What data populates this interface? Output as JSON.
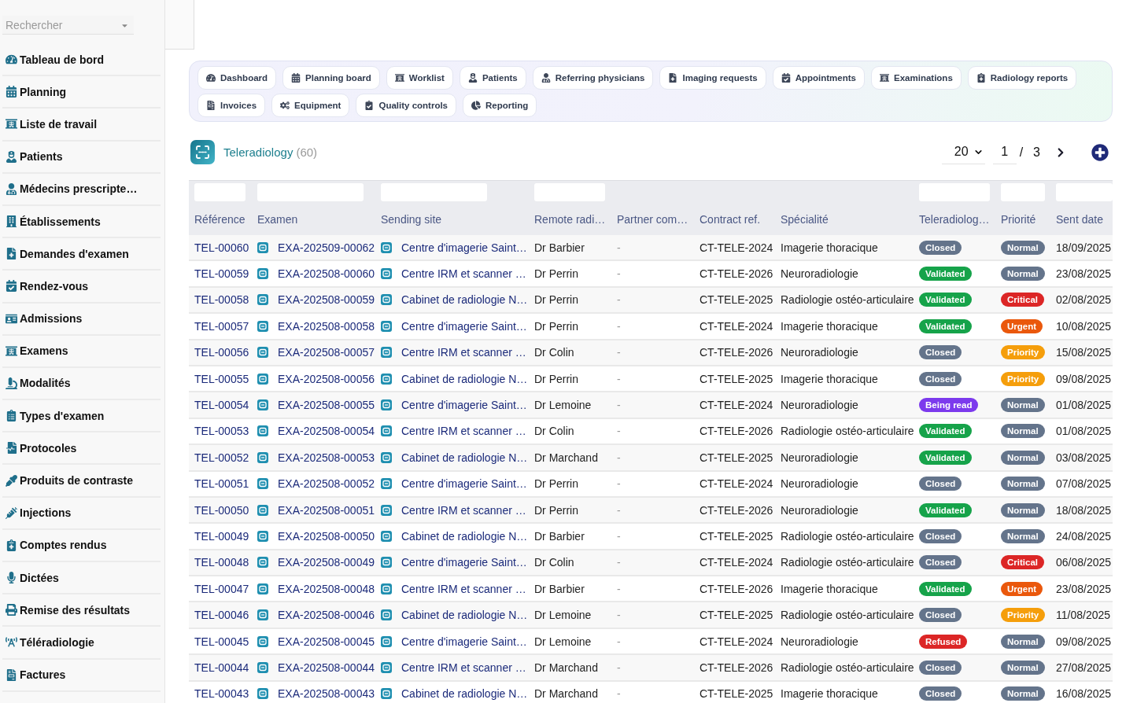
{
  "sidebar": {
    "search": {
      "placeholder": "Rechercher"
    },
    "items": [
      {
        "label": "Tableau de bord"
      },
      {
        "label": "Planning"
      },
      {
        "label": "Liste de travail"
      },
      {
        "label": "Patients"
      },
      {
        "label": "Médecins prescripte…"
      },
      {
        "label": "Établissements"
      },
      {
        "label": "Demandes d'examen"
      },
      {
        "label": "Rendez-vous"
      },
      {
        "label": "Admissions"
      },
      {
        "label": "Examens"
      },
      {
        "label": "Modalités"
      },
      {
        "label": "Types d'examen"
      },
      {
        "label": "Protocoles"
      },
      {
        "label": "Produits de contraste"
      },
      {
        "label": "Injections"
      },
      {
        "label": "Comptes rendus"
      },
      {
        "label": "Dictées"
      },
      {
        "label": "Remise des résultats"
      },
      {
        "label": "Téléradiologie"
      },
      {
        "label": "Factures"
      }
    ]
  },
  "nav_tabs": [
    {
      "label": "Dashboard"
    },
    {
      "label": "Planning board"
    },
    {
      "label": "Worklist"
    },
    {
      "label": "Patients"
    },
    {
      "label": "Referring physicians"
    },
    {
      "label": "Imaging requests"
    },
    {
      "label": "Appointments"
    },
    {
      "label": "Examinations"
    },
    {
      "label": "Radiology reports"
    },
    {
      "label": "Invoices"
    },
    {
      "label": "Equipment"
    },
    {
      "label": "Quality controls"
    },
    {
      "label": "Reporting"
    }
  ],
  "list_header": {
    "title": "Teleradiology",
    "count": "(60)",
    "page_size": "20",
    "page": "1",
    "page_separator": "/",
    "page_count": "3"
  },
  "table": {
    "columns": [
      {
        "label": "Référence",
        "filter": true
      },
      {
        "label": "Examen",
        "filter": true
      },
      {
        "label": "Sending site",
        "filter": true
      },
      {
        "label": "Remote radi…",
        "filter": true
      },
      {
        "label": "Partner com…",
        "filter": false
      },
      {
        "label": "Contract ref.",
        "filter": false
      },
      {
        "label": "Spécialité",
        "filter": false
      },
      {
        "label": "Teleradiolog…",
        "filter": true
      },
      {
        "label": "Priorité",
        "filter": true
      },
      {
        "label": "Sent date",
        "filter": true
      }
    ],
    "rows": [
      {
        "reference": "TEL-00060",
        "exam": "EXA-202509-00062",
        "sending_site": "Centre d'imagerie Saint…",
        "remote_radiologist": "Dr Barbier",
        "partner": "-",
        "contract_ref": "CT-TELE-2024",
        "specialty": "Imagerie thoracique",
        "status": {
          "label": "Closed",
          "color": "#64748b"
        },
        "priority": {
          "label": "Normal",
          "color": "#64748b"
        },
        "sent_date": "18/09/2025"
      },
      {
        "reference": "TEL-00059",
        "exam": "EXA-202508-00060",
        "sending_site": "Centre IRM et scanner …",
        "remote_radiologist": "Dr Perrin",
        "partner": "-",
        "contract_ref": "CT-TELE-2026",
        "specialty": "Neuroradiologie",
        "status": {
          "label": "Validated",
          "color": "#16a34a"
        },
        "priority": {
          "label": "Normal",
          "color": "#64748b"
        },
        "sent_date": "23/08/2025"
      },
      {
        "reference": "TEL-00058",
        "exam": "EXA-202508-00059",
        "sending_site": "Cabinet de radiologie N…",
        "remote_radiologist": "Dr Perrin",
        "partner": "-",
        "contract_ref": "CT-TELE-2025",
        "specialty": "Radiologie ostéo-articulaire",
        "status": {
          "label": "Validated",
          "color": "#16a34a"
        },
        "priority": {
          "label": "Critical",
          "color": "#dc2626"
        },
        "sent_date": "02/08/2025"
      },
      {
        "reference": "TEL-00057",
        "exam": "EXA-202508-00058",
        "sending_site": "Centre d'imagerie Saint…",
        "remote_radiologist": "Dr Perrin",
        "partner": "-",
        "contract_ref": "CT-TELE-2024",
        "specialty": "Imagerie thoracique",
        "status": {
          "label": "Validated",
          "color": "#16a34a"
        },
        "priority": {
          "label": "Urgent",
          "color": "#ea580c"
        },
        "sent_date": "10/08/2025"
      },
      {
        "reference": "TEL-00056",
        "exam": "EXA-202508-00057",
        "sending_site": "Centre IRM et scanner …",
        "remote_radiologist": "Dr Colin",
        "partner": "-",
        "contract_ref": "CT-TELE-2026",
        "specialty": "Neuroradiologie",
        "status": {
          "label": "Closed",
          "color": "#64748b"
        },
        "priority": {
          "label": "Priority",
          "color": "#f59e0b"
        },
        "sent_date": "15/08/2025"
      },
      {
        "reference": "TEL-00055",
        "exam": "EXA-202508-00056",
        "sending_site": "Cabinet de radiologie N…",
        "remote_radiologist": "Dr Perrin",
        "partner": "-",
        "contract_ref": "CT-TELE-2025",
        "specialty": "Imagerie thoracique",
        "status": {
          "label": "Closed",
          "color": "#64748b"
        },
        "priority": {
          "label": "Priority",
          "color": "#f59e0b"
        },
        "sent_date": "09/08/2025"
      },
      {
        "reference": "TEL-00054",
        "exam": "EXA-202508-00055",
        "sending_site": "Centre d'imagerie Saint…",
        "remote_radiologist": "Dr Lemoine",
        "partner": "-",
        "contract_ref": "CT-TELE-2024",
        "specialty": "Neuroradiologie",
        "status": {
          "label": "Being read",
          "color": "#7c3aed"
        },
        "priority": {
          "label": "Normal",
          "color": "#64748b"
        },
        "sent_date": "01/08/2025"
      },
      {
        "reference": "TEL-00053",
        "exam": "EXA-202508-00054",
        "sending_site": "Centre IRM et scanner …",
        "remote_radiologist": "Dr Colin",
        "partner": "-",
        "contract_ref": "CT-TELE-2026",
        "specialty": "Radiologie ostéo-articulaire",
        "status": {
          "label": "Validated",
          "color": "#16a34a"
        },
        "priority": {
          "label": "Normal",
          "color": "#64748b"
        },
        "sent_date": "01/08/2025"
      },
      {
        "reference": "TEL-00052",
        "exam": "EXA-202508-00053",
        "sending_site": "Cabinet de radiologie N…",
        "remote_radiologist": "Dr Marchand",
        "partner": "-",
        "contract_ref": "CT-TELE-2025",
        "specialty": "Neuroradiologie",
        "status": {
          "label": "Validated",
          "color": "#16a34a"
        },
        "priority": {
          "label": "Normal",
          "color": "#64748b"
        },
        "sent_date": "03/08/2025"
      },
      {
        "reference": "TEL-00051",
        "exam": "EXA-202508-00052",
        "sending_site": "Centre d'imagerie Saint…",
        "remote_radiologist": "Dr Perrin",
        "partner": "-",
        "contract_ref": "CT-TELE-2024",
        "specialty": "Neuroradiologie",
        "status": {
          "label": "Closed",
          "color": "#64748b"
        },
        "priority": {
          "label": "Normal",
          "color": "#64748b"
        },
        "sent_date": "07/08/2025"
      },
      {
        "reference": "TEL-00050",
        "exam": "EXA-202508-00051",
        "sending_site": "Centre IRM et scanner …",
        "remote_radiologist": "Dr Perrin",
        "partner": "-",
        "contract_ref": "CT-TELE-2026",
        "specialty": "Neuroradiologie",
        "status": {
          "label": "Validated",
          "color": "#16a34a"
        },
        "priority": {
          "label": "Normal",
          "color": "#64748b"
        },
        "sent_date": "18/08/2025"
      },
      {
        "reference": "TEL-00049",
        "exam": "EXA-202508-00050",
        "sending_site": "Cabinet de radiologie N…",
        "remote_radiologist": "Dr Barbier",
        "partner": "-",
        "contract_ref": "CT-TELE-2025",
        "specialty": "Radiologie ostéo-articulaire",
        "status": {
          "label": "Closed",
          "color": "#64748b"
        },
        "priority": {
          "label": "Normal",
          "color": "#64748b"
        },
        "sent_date": "24/08/2025"
      },
      {
        "reference": "TEL-00048",
        "exam": "EXA-202508-00049",
        "sending_site": "Centre d'imagerie Saint…",
        "remote_radiologist": "Dr Colin",
        "partner": "-",
        "contract_ref": "CT-TELE-2024",
        "specialty": "Radiologie ostéo-articulaire",
        "status": {
          "label": "Closed",
          "color": "#64748b"
        },
        "priority": {
          "label": "Critical",
          "color": "#dc2626"
        },
        "sent_date": "06/08/2025"
      },
      {
        "reference": "TEL-00047",
        "exam": "EXA-202508-00048",
        "sending_site": "Centre IRM et scanner …",
        "remote_radiologist": "Dr Barbier",
        "partner": "-",
        "contract_ref": "CT-TELE-2026",
        "specialty": "Imagerie thoracique",
        "status": {
          "label": "Validated",
          "color": "#16a34a"
        },
        "priority": {
          "label": "Urgent",
          "color": "#ea580c"
        },
        "sent_date": "23/08/2025"
      },
      {
        "reference": "TEL-00046",
        "exam": "EXA-202508-00046",
        "sending_site": "Cabinet de radiologie N…",
        "remote_radiologist": "Dr Lemoine",
        "partner": "-",
        "contract_ref": "CT-TELE-2025",
        "specialty": "Radiologie ostéo-articulaire",
        "status": {
          "label": "Closed",
          "color": "#64748b"
        },
        "priority": {
          "label": "Priority",
          "color": "#f59e0b"
        },
        "sent_date": "11/08/2025"
      },
      {
        "reference": "TEL-00045",
        "exam": "EXA-202508-00045",
        "sending_site": "Centre d'imagerie Saint…",
        "remote_radiologist": "Dr Lemoine",
        "partner": "-",
        "contract_ref": "CT-TELE-2024",
        "specialty": "Neuroradiologie",
        "status": {
          "label": "Refused",
          "color": "#dc2626"
        },
        "priority": {
          "label": "Normal",
          "color": "#64748b"
        },
        "sent_date": "09/08/2025"
      },
      {
        "reference": "TEL-00044",
        "exam": "EXA-202508-00044",
        "sending_site": "Centre IRM et scanner …",
        "remote_radiologist": "Dr Marchand",
        "partner": "-",
        "contract_ref": "CT-TELE-2026",
        "specialty": "Radiologie ostéo-articulaire",
        "status": {
          "label": "Closed",
          "color": "#64748b"
        },
        "priority": {
          "label": "Normal",
          "color": "#64748b"
        },
        "sent_date": "27/08/2025"
      },
      {
        "reference": "TEL-00043",
        "exam": "EXA-202508-00043",
        "sending_site": "Cabinet de radiologie N…",
        "remote_radiologist": "Dr Marchand",
        "partner": "-",
        "contract_ref": "CT-TELE-2025",
        "specialty": "Imagerie thoracique",
        "status": {
          "label": "Closed",
          "color": "#64748b"
        },
        "priority": {
          "label": "Normal",
          "color": "#64748b"
        },
        "sent_date": "16/08/2025"
      }
    ]
  }
}
